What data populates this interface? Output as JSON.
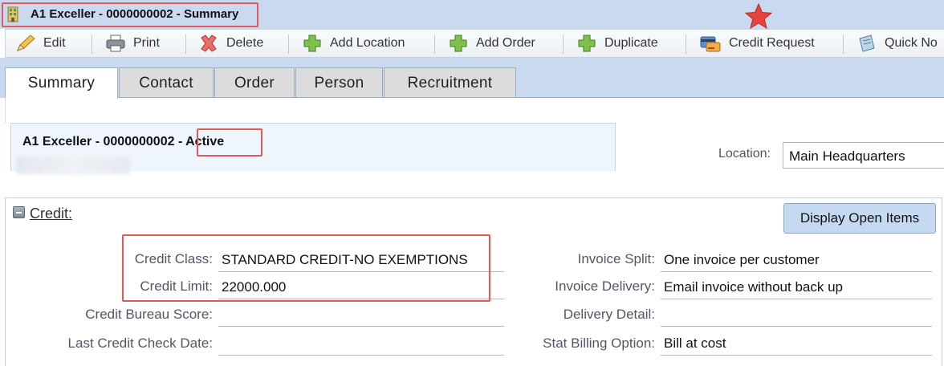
{
  "window": {
    "title": "A1 Exceller - 0000000002 - Summary",
    "title_icon": "building-icon",
    "favorite_icon": "star-icon",
    "accent_red": "#e05a5a",
    "star_color": "#e8423c"
  },
  "toolbar": {
    "items": [
      {
        "label": "Edit",
        "icon": "pencil-icon"
      },
      {
        "label": "Print",
        "icon": "printer-icon"
      },
      {
        "label": "Delete",
        "icon": "delete-x-icon"
      },
      {
        "label": "Add Location",
        "icon": "plus-icon"
      },
      {
        "label": "Add Order",
        "icon": "plus-icon"
      },
      {
        "label": "Duplicate",
        "icon": "plus-icon"
      },
      {
        "label": "Credit Request",
        "icon": "credit-card-icon"
      },
      {
        "label": "Quick No",
        "icon": "notepad-icon"
      }
    ]
  },
  "tabs": [
    {
      "label": "Summary",
      "active": true
    },
    {
      "label": "Contact",
      "active": false
    },
    {
      "label": "Order",
      "active": false
    },
    {
      "label": "Person",
      "active": false
    },
    {
      "label": "Recruitment",
      "active": false
    }
  ],
  "header": {
    "title_name": "A1 Exceller - 0000000002 ",
    "title_status": "- Active",
    "location_label": "Location:",
    "location_value": "Main Headquarters"
  },
  "credit": {
    "section_label": "Credit:",
    "display_open_items": "Display Open Items",
    "left_fields": [
      {
        "label": "Credit Class:",
        "value": "STANDARD CREDIT-NO EXEMPTIONS"
      },
      {
        "label": "Credit Limit:",
        "value": "22000.000"
      },
      {
        "label": "Credit Bureau Score:",
        "value": ""
      },
      {
        "label": "Last Credit Check Date:",
        "value": ""
      }
    ],
    "right_fields": [
      {
        "label": "Invoice Split:",
        "value": "One invoice per customer"
      },
      {
        "label": "Invoice Delivery:",
        "value": "Email invoice without back up"
      },
      {
        "label": "Delivery Detail:",
        "value": ""
      },
      {
        "label": "Stat Billing Option:",
        "value": "Bill at cost"
      }
    ]
  }
}
